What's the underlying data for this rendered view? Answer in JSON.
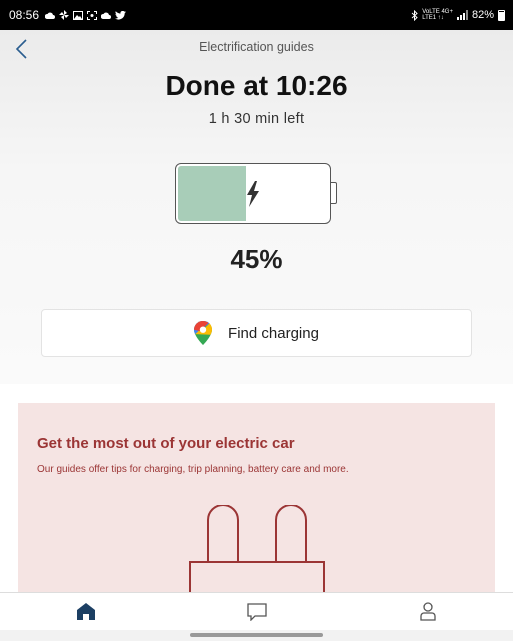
{
  "status_bar": {
    "time": "08:56",
    "icons": [
      "cloud-icon",
      "pinwheel-icon",
      "image-icon",
      "screenshot-icon",
      "cloud-icon",
      "twitter-icon"
    ],
    "right_icons": [
      "bluetooth-icon",
      "volte-icon",
      "4g-icon",
      "signal-icon"
    ],
    "net_top": "VoLTE 4G+",
    "net_bottom": "LTE1 ↑↓",
    "battery": "82%"
  },
  "header": {
    "back_icon": "chevron-left-icon",
    "title": "Electrification guides"
  },
  "charging": {
    "done_text": "Done at 10:26",
    "time_left": "1 h 30 min left",
    "level_fraction": 0.45,
    "percent_text": "45%",
    "fill_color": "#a8cdb8",
    "bolt_icon": "lightning-icon"
  },
  "find_charging": {
    "icon": "google-maps-pin-icon",
    "label": "Find charging"
  },
  "guide_card": {
    "title": "Get the most out of your electric car",
    "text": "Our guides offer tips for charging, trip planning, battery care and more.",
    "background": "#f5e4e3",
    "accent": "#9b3535",
    "illustration": "plug-icon"
  },
  "bottom_nav": {
    "items": [
      {
        "icon": "home-icon",
        "active": true
      },
      {
        "icon": "chat-icon",
        "active": false
      },
      {
        "icon": "profile-icon",
        "active": false
      }
    ],
    "active_color": "#1c3f63"
  }
}
